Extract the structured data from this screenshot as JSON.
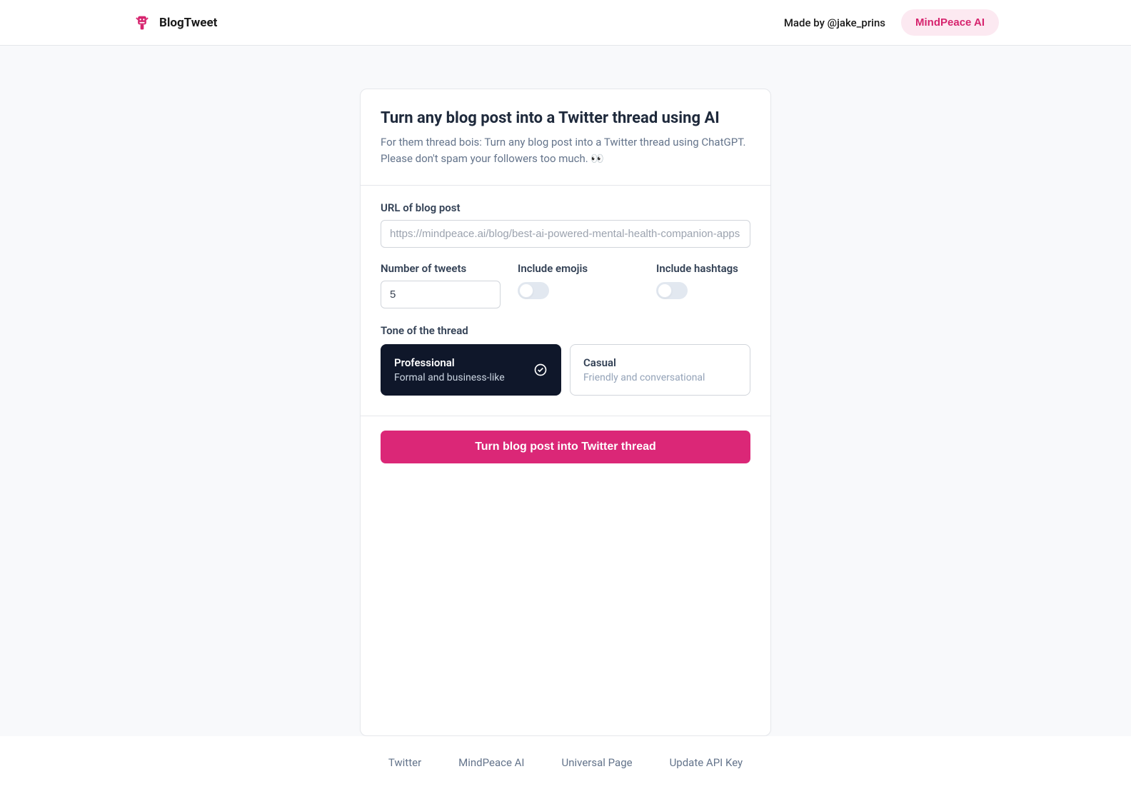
{
  "header": {
    "brand_name": "BlogTweet",
    "made_by": "Made by @jake_prins",
    "mindpeace_label": "MindPeace AI"
  },
  "card": {
    "title": "Turn any blog post into a Twitter thread using AI",
    "subtitle": "For them thread bois: Turn any blog post into a Twitter thread using ChatGPT. Please don't spam your followers too much. 👀"
  },
  "form": {
    "url_label": "URL of blog post",
    "url_placeholder": "https://mindpeace.ai/blog/best-ai-powered-mental-health-companion-apps",
    "url_value": "",
    "tweets_label": "Number of tweets",
    "tweets_value": "5",
    "emojis_label": "Include emojis",
    "emojis_on": false,
    "hashtags_label": "Include hashtags",
    "hashtags_on": false,
    "tone_label": "Tone of the thread",
    "tones": [
      {
        "title": "Professional",
        "desc": "Formal and business-like",
        "selected": true
      },
      {
        "title": "Casual",
        "desc": "Friendly and conversational",
        "selected": false
      }
    ],
    "submit_label": "Turn blog post into Twitter thread"
  },
  "footer": {
    "links": [
      "Twitter",
      "MindPeace AI",
      "Universal Page",
      "Update API Key"
    ]
  },
  "colors": {
    "accent": "#db2777",
    "accent_light": "#fce9f1",
    "dark": "#0f172a"
  }
}
